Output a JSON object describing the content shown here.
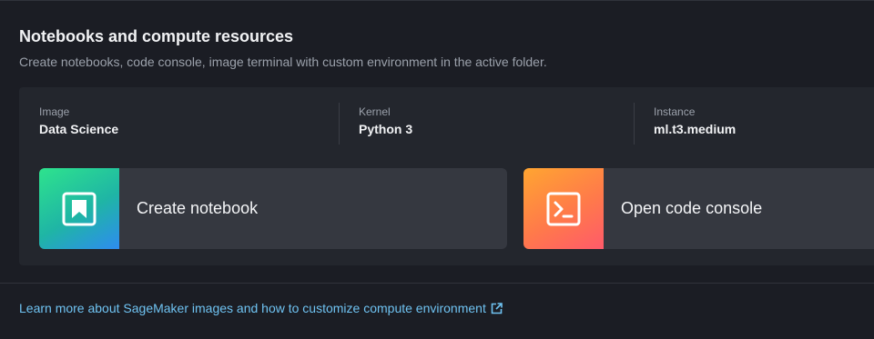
{
  "section": {
    "title": "Notebooks and compute resources",
    "subtitle": "Create notebooks, code console, image terminal with custom environment in the active folder."
  },
  "environment": {
    "image_label": "Image",
    "image_value": "Data Science",
    "kernel_label": "Kernel",
    "kernel_value": "Python 3",
    "instance_label": "Instance",
    "instance_value": "ml.t3.medium"
  },
  "actions": {
    "create_notebook": {
      "label": "Create notebook",
      "icon": "notebook-icon"
    },
    "open_code_console": {
      "label": "Open code console",
      "icon": "terminal-icon"
    }
  },
  "footer": {
    "learn_more_link": "Learn more about SageMaker images and how to customize compute environment",
    "link_icon": "external-link-icon"
  },
  "colors": {
    "background": "#1b1d24",
    "panel": "#23262d",
    "card": "#353840",
    "link": "#6fc3f2"
  }
}
